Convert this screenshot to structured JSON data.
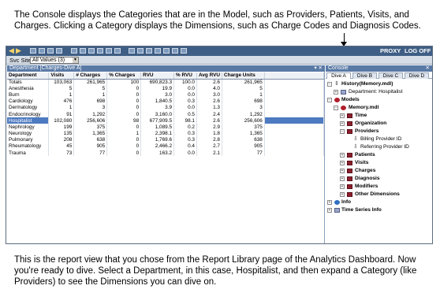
{
  "captions": {
    "top": "The Console displays the Categories that are in the Model, such as Providers, Patients, Visits, and Charges. Clicking a Category displays the Dimensions, such as Charge Codes and Diagnosis Codes.",
    "bottom": "This is the report view that you chose from the Report Library page of the Analytics Dashboard. Now you're ready to dive. Select a Department, in this case, Hospitalist, and then expand a Category (like Providers) to see the Dimensions you can dive on."
  },
  "toolbar": {
    "proxy_label": "PROXY",
    "logoff_label": "LOG OFF"
  },
  "svc": {
    "label": "Svc Site",
    "value": "All Values (3)"
  },
  "report": {
    "title": "Department [Charges-Dive A]",
    "controls": "▾ ✕",
    "columns": [
      "Department",
      "Visits",
      "# Charges",
      "% Charges",
      "RVU",
      "% RVU",
      "Avg RVU",
      "Charge Units"
    ],
    "rows": [
      [
        "Totals",
        "103,063",
        "261,965",
        "100",
        "690,823.3",
        "100.0",
        "2.6",
        "261,965"
      ],
      [
        "Anesthesia",
        "5",
        "5",
        "0",
        "19.9",
        "0.0",
        "4.0",
        "5"
      ],
      [
        "Burn",
        "1",
        "1",
        "0",
        "3.0",
        "0.0",
        "3.0",
        "1"
      ],
      [
        "Cardiology",
        "476",
        "698",
        "0",
        "1,840.5",
        "0.3",
        "2.6",
        "698"
      ],
      [
        "Dermatology",
        "1",
        "3",
        "0",
        "3.9",
        "0.0",
        "1.3",
        "3"
      ],
      [
        "Endocrinology",
        "91",
        "1,292",
        "0",
        "3,160.0",
        "0.5",
        "2.4",
        "1,292"
      ],
      [
        "Hospitalist",
        "102,080",
        "256,606",
        "98",
        "677,909.5",
        "98.1",
        "2.6",
        "256,606"
      ],
      [
        "Nephrology",
        "199",
        "375",
        "0",
        "1,089.5",
        "0.2",
        "2.9",
        "375"
      ],
      [
        "Neurology",
        "135",
        "1,365",
        "1",
        "2,398.1",
        "0.3",
        "1.8",
        "1,365"
      ],
      [
        "Pulmonary",
        "208",
        "638",
        "0",
        "1,769.6",
        "0.3",
        "2.8",
        "638"
      ],
      [
        "Rheumatology",
        "45",
        "905",
        "0",
        "2,466.2",
        "0.4",
        "2.7",
        "905"
      ],
      [
        "Trauma",
        "73",
        "77",
        "0",
        "163.2",
        "0.0",
        "2.1",
        "77"
      ]
    ],
    "selected_row": "Hospitalist"
  },
  "console": {
    "title": "Console",
    "close": "✕",
    "tabs": [
      "Dive A",
      "Dive B",
      "Dive C",
      "Dive D"
    ],
    "active_tab": "Dive A",
    "tree": {
      "history": "History(Memory.mdl)",
      "history_child": "Department: Hospitalist",
      "models": "Models",
      "model_file": "Memory.mdl",
      "categories": {
        "time": "Time",
        "organization": "Organization",
        "providers": "Providers",
        "provider_dims": [
          "Billing Provider ID",
          "Referring Provider ID"
        ],
        "patients": "Patients",
        "visits": "Visits",
        "charges": "Charges",
        "diagnosis": "Diagnosis",
        "modifiers": "Modifiers",
        "other": "Other Dimensions"
      },
      "info": "Info",
      "time_series": "Time Series Info"
    }
  }
}
